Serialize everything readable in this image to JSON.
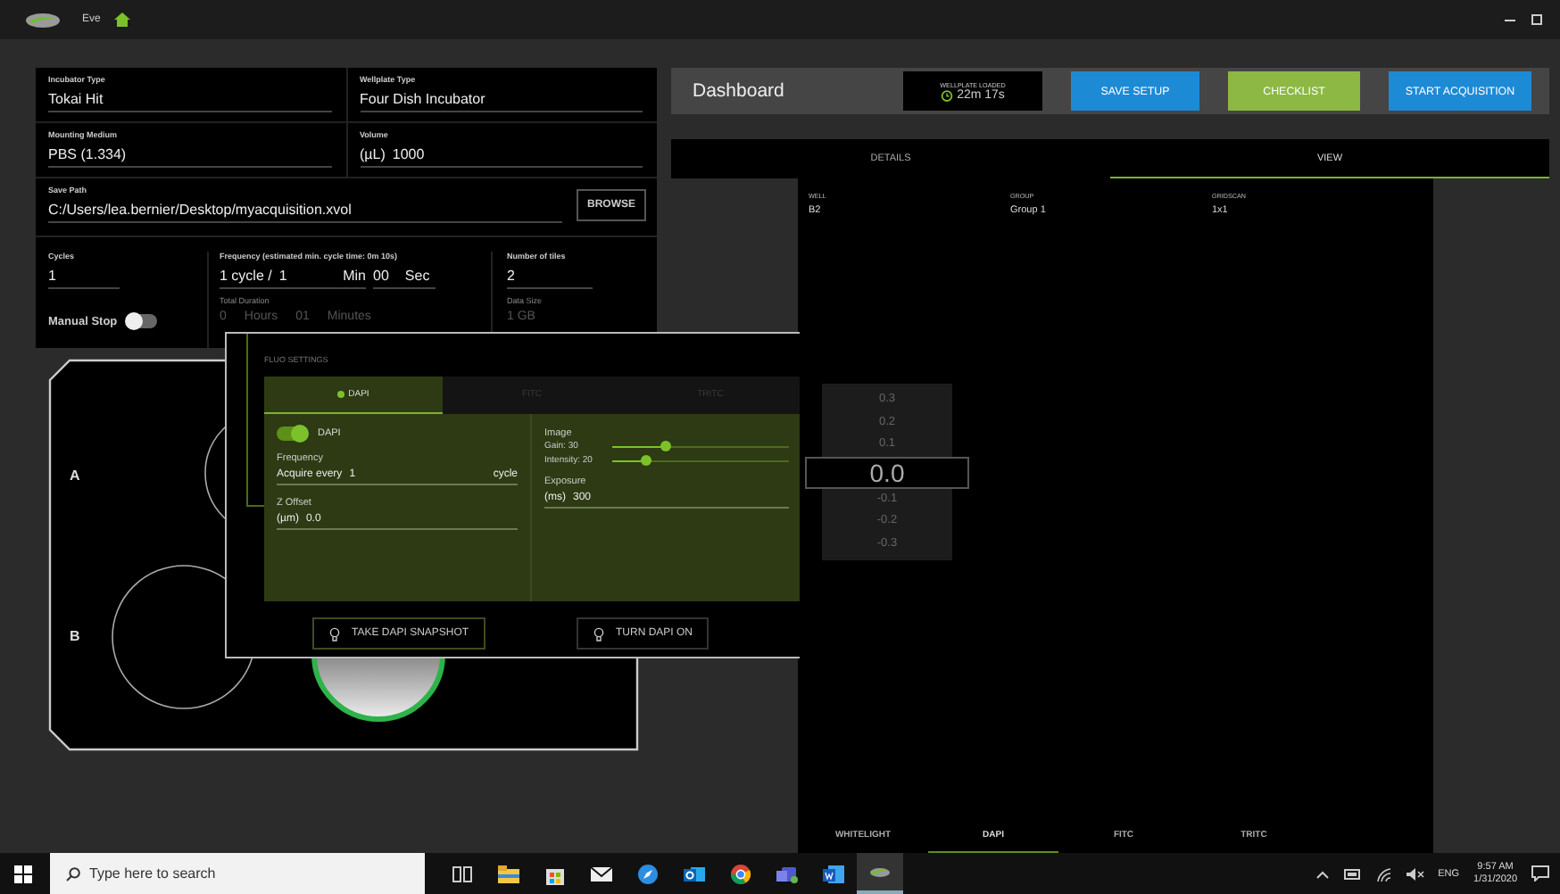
{
  "titlebar": {
    "app_name": "Eve"
  },
  "setup": {
    "incubator_type": {
      "label": "Incubator Type",
      "value": "Tokai Hit"
    },
    "wellplate_type": {
      "label": "Wellplate Type",
      "value": "Four Dish Incubator"
    },
    "mounting_medium": {
      "label": "Mounting Medium",
      "value": "PBS (1.334)"
    },
    "volume": {
      "label": "Volume",
      "unit": "(µL)",
      "value": "1000"
    },
    "save_path": {
      "label": "Save Path",
      "value": "C:/Users/lea.bernier/Desktop/myacquisition.xvol",
      "button": "BROWSE"
    },
    "cycles": {
      "label": "Cycles",
      "value": "1"
    },
    "manual_stop": {
      "label": "Manual Stop",
      "on": false
    },
    "frequency": {
      "label": "Frequency (estimated min. cycle time: 0m 10s)",
      "prefix": "1 cycle /",
      "min_value": "1",
      "min_unit": "Min",
      "sec_value": "00",
      "sec_unit": "Sec"
    },
    "total_duration": {
      "label": "Total Duration",
      "hours_value": "0",
      "hours_unit": "Hours",
      "minutes_value": "01",
      "minutes_unit": "Minutes"
    },
    "number_of_tiles": {
      "label": "Number of tiles",
      "value": "2"
    },
    "data_size": {
      "label": "Data Size",
      "value": "1 GB"
    }
  },
  "plate": {
    "rows": [
      "A",
      "B"
    ]
  },
  "dashboard": {
    "title": "Dashboard",
    "status": {
      "label": "WELLPLATE LOADED",
      "time": "22m 17s"
    },
    "buttons": [
      {
        "label": "SAVE SETUP",
        "kind": "blue"
      },
      {
        "label": "CHECKLIST",
        "kind": "green"
      },
      {
        "label": "START ACQUISITION",
        "kind": "blue"
      }
    ]
  },
  "view_tabs": [
    {
      "label": "DETAILS",
      "selected": false
    },
    {
      "label": "VIEW",
      "selected": true
    }
  ],
  "well_info": [
    {
      "label": "WELL",
      "value": "B2"
    },
    {
      "label": "GROUP",
      "value": "Group 1"
    },
    {
      "label": "GRIDSCAN",
      "value": "1x1"
    }
  ],
  "z_scale": [
    {
      "label": "0.3",
      "selected": false
    },
    {
      "label": "0.2",
      "selected": false
    },
    {
      "label": "0.1",
      "selected": false
    },
    {
      "label": "0.0",
      "selected": true
    },
    {
      "label": "-0.1",
      "selected": false
    },
    {
      "label": "-0.2",
      "selected": false
    },
    {
      "label": "-0.3",
      "selected": false
    }
  ],
  "channel_tabs": [
    {
      "label": "WHITELIGHT",
      "selected": false
    },
    {
      "label": "DAPI",
      "selected": true
    },
    {
      "label": "FITC",
      "selected": false
    },
    {
      "label": "TRITC",
      "selected": false
    }
  ],
  "fluo_settings": {
    "title": "FLUO SETTINGS",
    "tabs": [
      {
        "label": "DAPI",
        "selected": true,
        "active": true
      },
      {
        "label": "FITC",
        "selected": false,
        "active": false
      },
      {
        "label": "TRITC",
        "selected": false,
        "active": false
      }
    ],
    "toggle": {
      "label": "DAPI",
      "on": true
    },
    "frequency": {
      "label": "Frequency",
      "prefix": "Acquire every",
      "value": "1",
      "unit": "cycle"
    },
    "z_offset": {
      "label": "Z Offset",
      "unit": "(µm)",
      "value": "0.0"
    },
    "image": {
      "label": "Image",
      "sliders": [
        {
          "label": "Gain: 30",
          "level": 0.3
        },
        {
          "label": "Intensity: 20",
          "level": 0.19
        }
      ]
    },
    "exposure": {
      "label": "Exposure",
      "unit": "(ms)",
      "value": "300"
    },
    "buttons": [
      "TAKE DAPI SNAPSHOT",
      "TURN DAPI ON"
    ]
  },
  "taskbar": {
    "search_placeholder": "Type here to search",
    "apps": [
      {
        "kind": "task-view",
        "active": false
      },
      {
        "kind": "folder",
        "active": false
      },
      {
        "kind": "store",
        "active": false
      },
      {
        "kind": "mail",
        "active": false
      },
      {
        "kind": "compass",
        "active": false
      },
      {
        "kind": "outlook",
        "active": false
      },
      {
        "kind": "chrome",
        "active": false
      },
      {
        "kind": "teams",
        "active": false
      },
      {
        "kind": "word",
        "active": false
      },
      {
        "kind": "eve",
        "active": true
      }
    ],
    "language": "ENG",
    "time": "9:57 AM",
    "date": "1/31/2020"
  }
}
